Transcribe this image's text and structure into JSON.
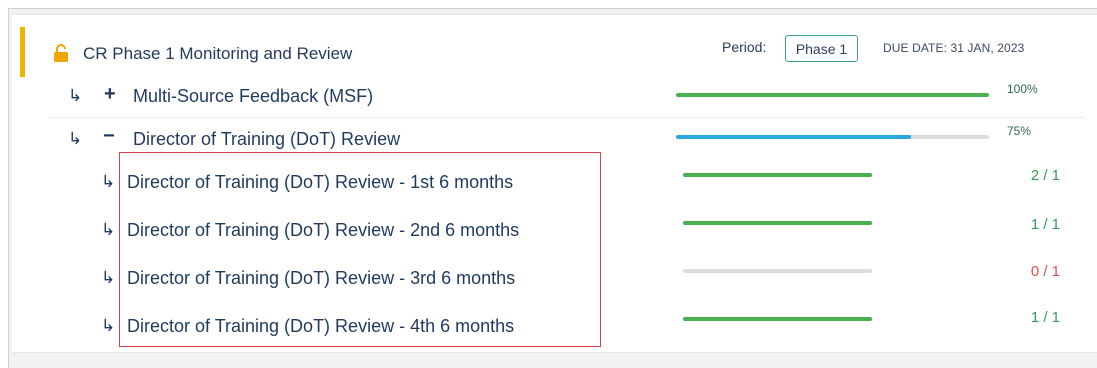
{
  "header": {
    "title": "CR Phase 1 Monitoring and Review",
    "period_label": "Period:",
    "period_value": "Phase 1",
    "due_date": "DUE DATE: 31 JAN, 2023",
    "accent_color": "#f0b400",
    "lock_icon": "unlocked-padlock-icon"
  },
  "groups": [
    {
      "sign": "+",
      "label": "Multi-Source Feedback (MSF)",
      "percent": "100%",
      "progress": 1.0,
      "bar_color": "#4caf50"
    },
    {
      "sign": "−",
      "label": "Director of Training (DoT) Review",
      "percent": "75%",
      "progress": 0.75,
      "bar_color": "#2aa8e0"
    }
  ],
  "items": [
    {
      "label": "Director of Training (DoT) Review - 1st 6 months",
      "count": "2 / 1",
      "count_color": "#3a9a55",
      "progress": 1.0
    },
    {
      "label": "Director of Training (DoT) Review - 2nd 6 months",
      "count": "1 / 1",
      "count_color": "#3a9a55",
      "progress": 1.0
    },
    {
      "label": "Director of Training (DoT) Review - 3rd 6 months",
      "count": "0 / 1",
      "count_color": "#d9534f",
      "progress": 0.0
    },
    {
      "label": "Director of Training (DoT) Review - 4th 6 months",
      "count": "1 / 1",
      "count_color": "#3a9a55",
      "progress": 1.0
    }
  ]
}
